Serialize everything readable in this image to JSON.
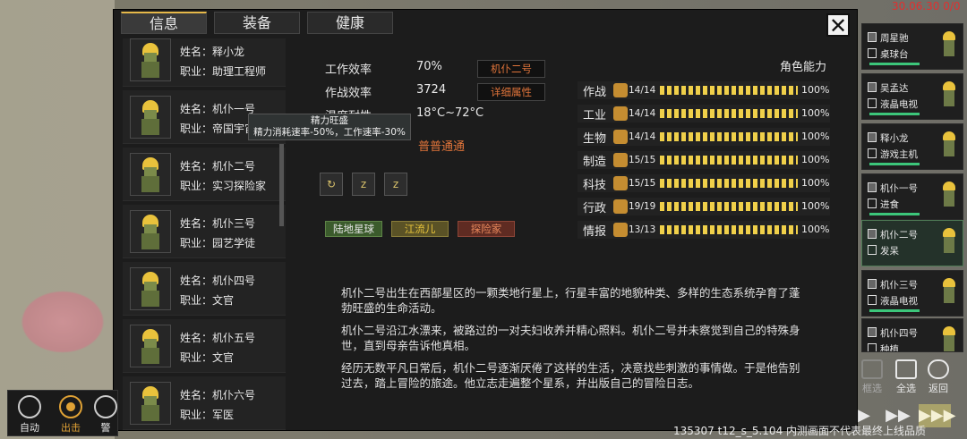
{
  "status": {
    "clock": "30.06.30 0/0"
  },
  "tabs": [
    "信息",
    "装备",
    "健康"
  ],
  "close_label": "✕",
  "character_list": [
    {
      "name": "姓名：释小龙",
      "job": "职业：助理工程师"
    },
    {
      "name": "姓名：机仆一号",
      "job": "职业：帝国宇宙"
    },
    {
      "name": "姓名：机仆二号",
      "job": "职业：实习探险家"
    },
    {
      "name": "姓名：机仆三号",
      "job": "职业：园艺学徒"
    },
    {
      "name": "姓名：机仆四号",
      "job": "职业：文官"
    },
    {
      "name": "姓名：机仆五号",
      "job": "职业：文官"
    },
    {
      "name": "姓名：机仆六号",
      "job": "职业：军医"
    }
  ],
  "tooltip": {
    "title": "精力旺盛",
    "desc": "精力消耗速率-50%，工作速率-30%"
  },
  "info": {
    "work_eff_label": "工作效率",
    "work_eff_value": "70%",
    "combat_eff_label": "作战效率",
    "combat_eff_value": "3724",
    "temp_label": "温度耐性",
    "temp_value": "18°C~72°C",
    "mood": "普普通通",
    "name_box": "机仆二号",
    "detail_button": "详细属性"
  },
  "trait_icons": [
    "recycle-icon",
    "sleep-icon",
    "rest-icon"
  ],
  "tags": [
    "陆地星球",
    "江流儿",
    "探险家"
  ],
  "abilities_title": "角色能力",
  "abilities": [
    {
      "name": "作战",
      "level": "14/14",
      "pct": "100%"
    },
    {
      "name": "工业",
      "level": "14/14",
      "pct": "100%"
    },
    {
      "name": "生物",
      "level": "14/14",
      "pct": "100%"
    },
    {
      "name": "制造",
      "level": "15/15",
      "pct": "100%"
    },
    {
      "name": "科技",
      "level": "15/15",
      "pct": "100%"
    },
    {
      "name": "行政",
      "level": "19/19",
      "pct": "100%"
    },
    {
      "name": "情报",
      "level": "13/13",
      "pct": "100%"
    }
  ],
  "bio": [
    "机仆二号出生在西部星区的一颗类地行星上，行星丰富的地貌种类、多样的生态系统孕育了蓬勃旺盛的生命活动。",
    "机仆二号沿江水漂来，被路过的一对夫妇收养并精心照料。机仆二号并未察觉到自己的特殊身世，直到母亲告诉他真相。",
    "经历无数平凡日常后，机仆二号逐渐厌倦了这样的生活，决意找些刺激的事情做。于是他告别过去，踏上冒险的旅途。他立志走遍整个星系，并出版自己的冒险日志。"
  ],
  "roster": [
    {
      "name": "周星驰",
      "task": "桌球台"
    },
    {
      "name": "吴孟达",
      "task": "液晶电视"
    },
    {
      "name": "释小龙",
      "task": "游戏主机"
    },
    {
      "name": "机仆一号",
      "task": "进食"
    },
    {
      "name": "机仆二号",
      "task": "发呆"
    },
    {
      "name": "机仆三号",
      "task": "液晶电视"
    },
    {
      "name": "机仆四号",
      "task": "种植"
    }
  ],
  "dock": {
    "auto": "自动",
    "go": "出击",
    "warn": "警"
  },
  "controls": {
    "frame": "框选",
    "all": "全选",
    "back": "返回"
  },
  "speed": [
    "▶",
    "▶▶",
    "▶▶▶"
  ],
  "footer": "135307 t12_s_5.104  内测画面不代表最终上线品质"
}
